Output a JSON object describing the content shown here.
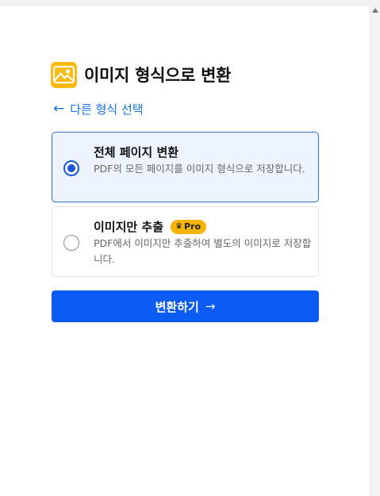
{
  "header": {
    "icon": "image-icon",
    "title": "이미지 형식으로 변환",
    "icon_color": "#fdba12"
  },
  "back": {
    "label": "다른 형식 선택",
    "icon": "arrow-left-icon"
  },
  "options": [
    {
      "title": "전체 페이지 변환",
      "description": "PDF의 모든 페이지를 이미지 형식으로 저장합니다.",
      "selected": true
    },
    {
      "title": "이미지만 추출",
      "description": "PDF에서 이미지만 추출하여 별도의 이미지로 저장합니다.",
      "selected": false,
      "badge": "Pro",
      "badge_icon": "crown-icon"
    }
  ],
  "convert_button": {
    "label": "변환하기",
    "icon": "arrow-right-icon"
  },
  "colors": {
    "accent": "#0b5cf5",
    "link": "#1a73e8",
    "selected_bg": "#eef4ff",
    "selected_border": "#2f6fd6",
    "pro_badge": "#f7b500"
  }
}
